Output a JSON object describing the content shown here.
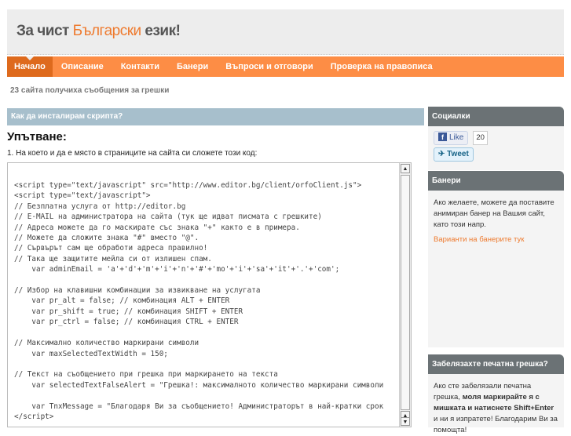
{
  "header": {
    "title_a": "За чист ",
    "title_b": "Български",
    "title_c": " език!"
  },
  "nav": [
    "Начало",
    "Описание",
    "Контакти",
    "Банери",
    "Въпроси и отговори",
    "Проверка на правописа"
  ],
  "counter": "23 сайта получиха съобщения за грешки",
  "howto": {
    "title": "Как да инсталирам скрипта?",
    "heading": "Упътване:",
    "step": "1. На което и да е място в страниците на сайта си сложете този код:"
  },
  "code": "<script type=\"text/javascript\" src=\"http://www.editor.bg/client/orfoClient.js\">\n<script type=\"text/javascript\">\n// Безплатна услуга от http://editor.bg\n// E-MAIL на администратора на сайта (тук ще идват писмата с грешките)\n// Адреса можете да го маскирате със знака \"+\" както е в примера.\n// Можете да сложите знака \"#\" вместо \"@\".\n// Сървърът сам ще обработи адреса правилно!\n// Така ще защитите мейла си от излишен спам.\n    var adminEmail = 'a'+'d'+'m'+'i'+'n'+'#'+'mo'+'i'+'sa'+'it'+'.'+'com';\n\n// Избор на клавишни комбинации за извикване на услугата\n    var pr_alt = false; // комбинация ALT + ENTER\n    var pr_shift = true; // комбинация SHIFT + ENTER\n    var pr_ctrl = false; // комбинация CTRL + ENTER\n\n// Максимално количество маркирани символи\n    var maxSelectedTextWidth = 150;\n\n// Текст на съобщението при грешка при маркирането на текста\n    var selectedTextFalseAlert = \"Грешка!: максималното количество маркирани символи\n\n    var TnxMessage = \"Благодаря Ви за съобщението! Администраторът в най-кратки срок\n</script>",
  "sidebar": {
    "social": {
      "title": "Социалки",
      "like": "Like",
      "like_count": "20",
      "tweet": "Tweet"
    },
    "banners": {
      "title": "Банери",
      "text": "Ако желаете, можете да поставите анимиран банер на Вашия сайт, като този напр.",
      "link": "Варианти на банерите тук"
    },
    "typo": {
      "title": "Забелязахте печатна грешка?",
      "text_a": "Ако сте забелязали печатна грешка, ",
      "text_b": "моля маркирайте я с мишката и натиснете Shift+Enter",
      "text_c": " и ни я изпратете! Благодарим Ви за помощта!"
    }
  }
}
